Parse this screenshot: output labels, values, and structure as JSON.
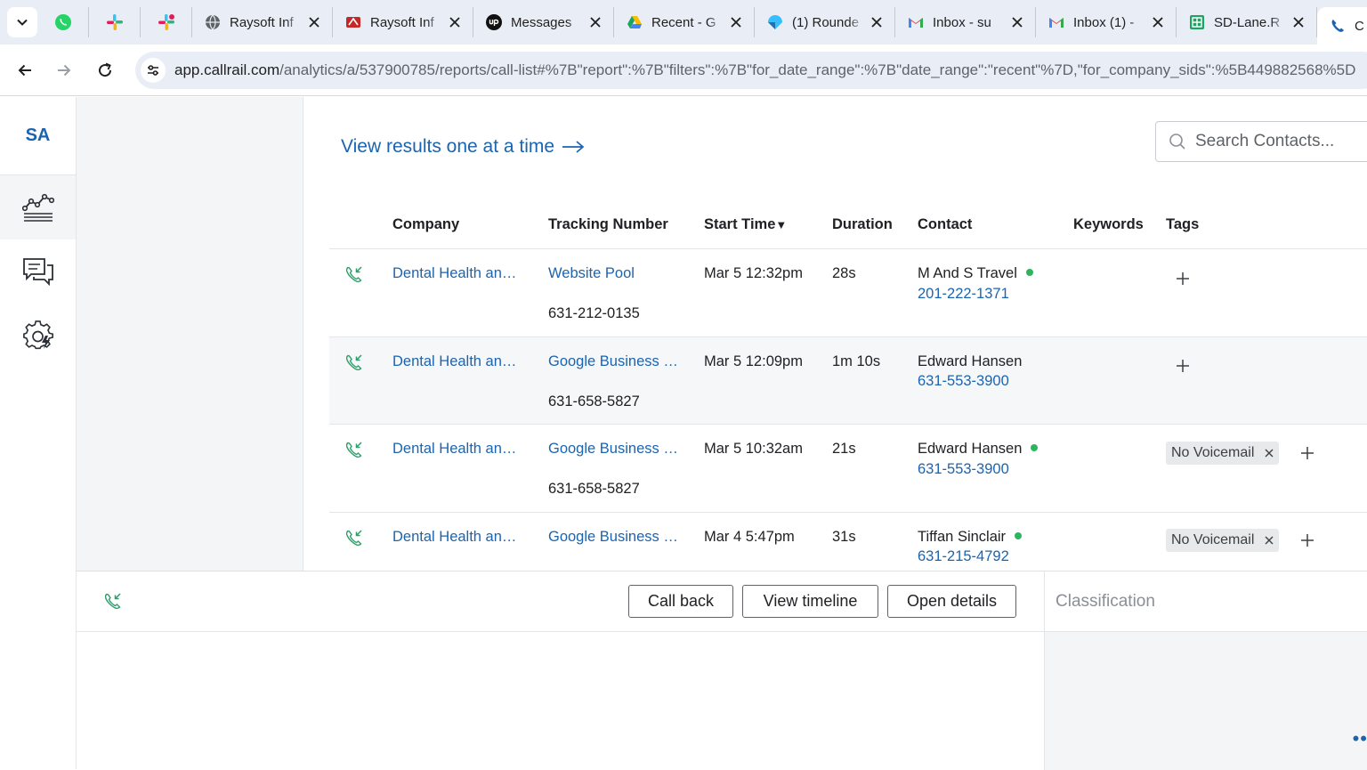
{
  "browser": {
    "tabs": [
      {
        "title": "Raysoft Inf",
        "icon": "globe-icon"
      },
      {
        "title": "Raysoft Inf",
        "icon": "raysoft-icon"
      },
      {
        "title": "Messages",
        "icon": "upwork-icon"
      },
      {
        "title": "Recent - G",
        "icon": "drive-icon"
      },
      {
        "title": "(1) Rounde",
        "icon": "roundcube-icon"
      },
      {
        "title": "Inbox - su",
        "icon": "gmail-icon"
      },
      {
        "title": "Inbox (1) -",
        "icon": "gmail-icon"
      },
      {
        "title": "SD-Lane.R",
        "icon": "sheets-icon"
      },
      {
        "title": "C",
        "icon": "callrail-icon"
      }
    ],
    "url_host": "app.callrail.com",
    "url_path": "/analytics/a/537900785/reports/call-list#%7B\"report\":%7B\"filters\":%7B\"for_date_range\":%7B\"date_range\":\"recent\"%7D,\"for_company_sids\":%5B449882568%5D"
  },
  "rail": {
    "avatar": "SA"
  },
  "main": {
    "view_one": "View results one at a time",
    "search_placeholder": "Search Contacts..."
  },
  "table": {
    "headers": {
      "company": "Company",
      "tracking": "Tracking Number",
      "start": "Start Time",
      "duration": "Duration",
      "contact": "Contact",
      "keywords": "Keywords",
      "tags": "Tags"
    },
    "sort_indicator": "▼",
    "rows": [
      {
        "company": "Dental Health an…",
        "tracking_source": "Website Pool",
        "tracking_number": "631-212-0135",
        "start": "Mar 5 12:32pm",
        "duration": "28s",
        "contact_name": "M And S Travel",
        "contact_phone": "201-222-1371",
        "tag": ""
      },
      {
        "company": "Dental Health an…",
        "tracking_source": "Google Business …",
        "tracking_number": "631-658-5827",
        "start": "Mar 5 12:09pm",
        "duration": "1m 10s",
        "contact_name": "Edward Hansen",
        "contact_phone": "631-553-3900",
        "tag": ""
      },
      {
        "company": "Dental Health an…",
        "tracking_source": "Google Business …",
        "tracking_number": "631-658-5827",
        "start": "Mar 5 10:32am",
        "duration": "21s",
        "contact_name": "Edward Hansen",
        "contact_phone": "631-553-3900",
        "tag": "No Voicemail"
      },
      {
        "company": "Dental Health an…",
        "tracking_source": "Google Business …",
        "tracking_number": "",
        "start": "Mar 4 5:47pm",
        "duration": "31s",
        "contact_name": "Tiffan Sinclair",
        "contact_phone": "631-215-4792",
        "tag": "No Voicemail"
      }
    ]
  },
  "bottom": {
    "call_back": "Call back",
    "view_timeline": "View timeline",
    "open_details": "Open details",
    "classification": "Classification"
  },
  "colors": {
    "link": "#1b64b0",
    "call_icon": "#2e9e6a",
    "online_dot": "#2db55d",
    "panel_bg": "#f4f5f7"
  }
}
